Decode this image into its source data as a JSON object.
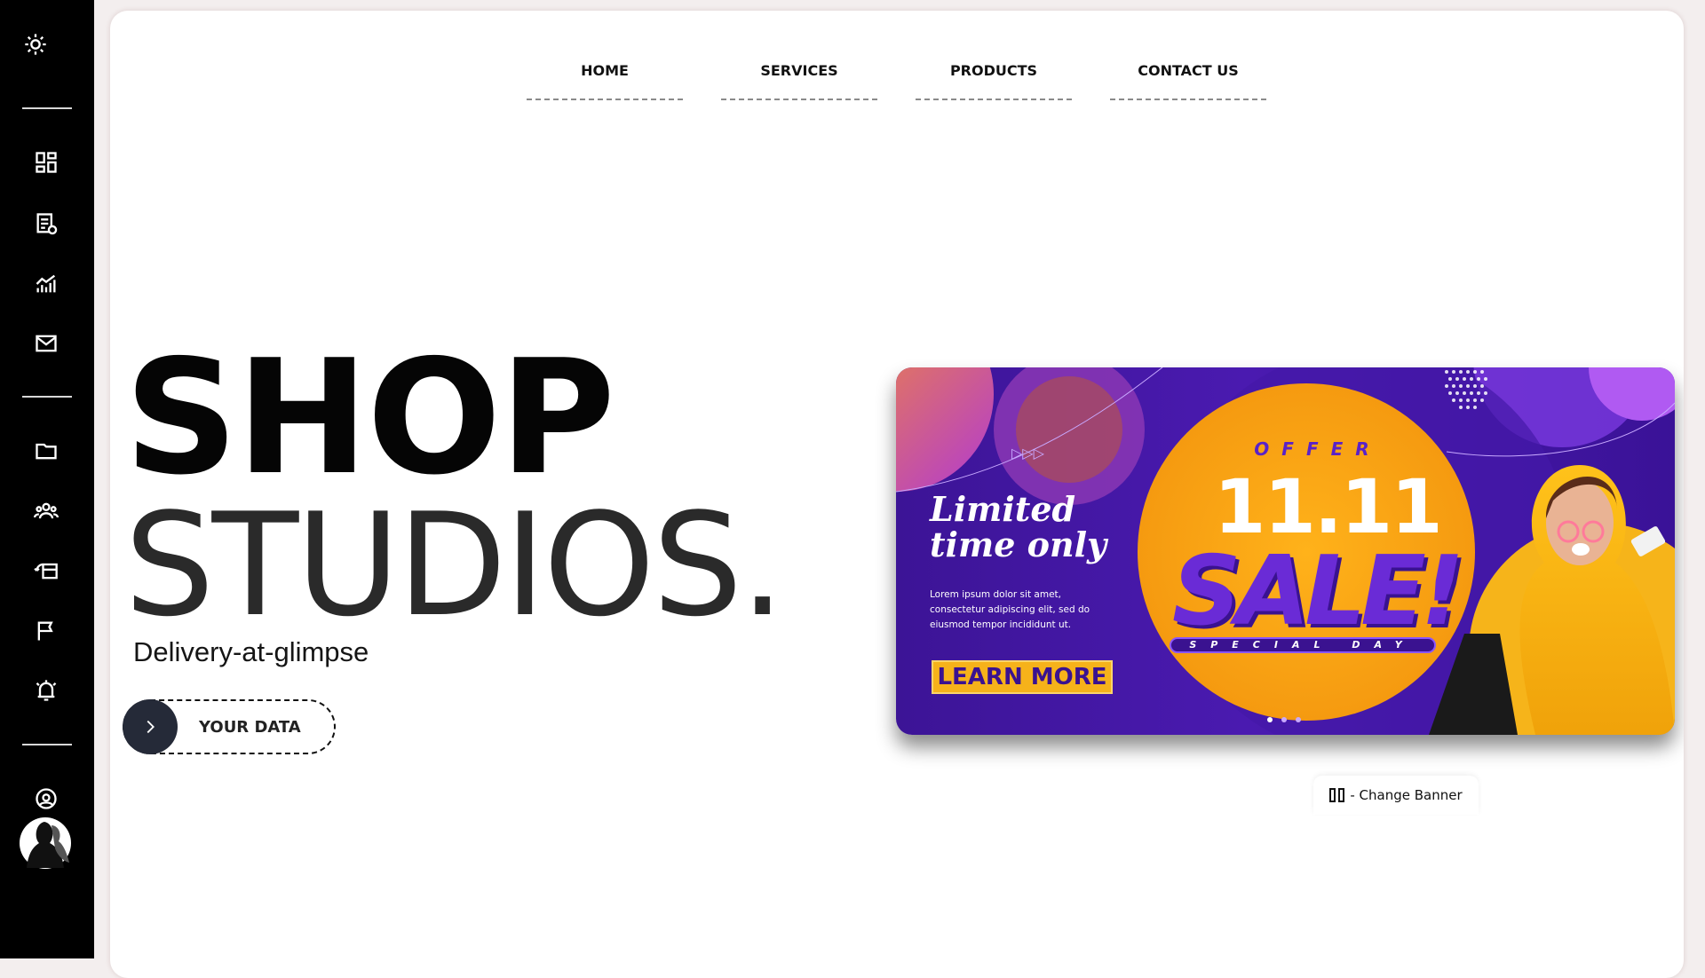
{
  "nav": {
    "items": [
      {
        "label": "HOME"
      },
      {
        "label": "SERVICES"
      },
      {
        "label": "PRODUCTS"
      },
      {
        "label": "CONTACT US"
      }
    ]
  },
  "hero": {
    "line1": "SHOP",
    "line2": "STUDIOS.",
    "tagline": "Delivery-at-glimpse",
    "button_label": "YOUR DATA"
  },
  "banner": {
    "headline": "Limited time only",
    "body": "Lorem ipsum dolor sit amet, consectetur adipiscing elit, sed do eiusmod tempor incididunt ut.",
    "cta": "LEARN MORE",
    "offer": "OFFER",
    "date": "11.11",
    "sale": "SALE!",
    "special": "SPECIAL DAY",
    "slides": 3,
    "active_slide": 1
  },
  "change_banner": {
    "label": "- Change Banner"
  },
  "sidebar": {
    "icons": [
      "settings-heart-icon",
      "dashboard-icon",
      "reports-icon",
      "analytics-icon",
      "mail-icon",
      "folder-icon",
      "team-icon",
      "payments-icon",
      "flag-icon",
      "alarm-icon",
      "profile-icon"
    ]
  },
  "colors": {
    "sidebar": "#000000",
    "accent_purple": "#4a1ab0",
    "accent_orange": "#f6a81a",
    "button_circle": "#252a38"
  }
}
